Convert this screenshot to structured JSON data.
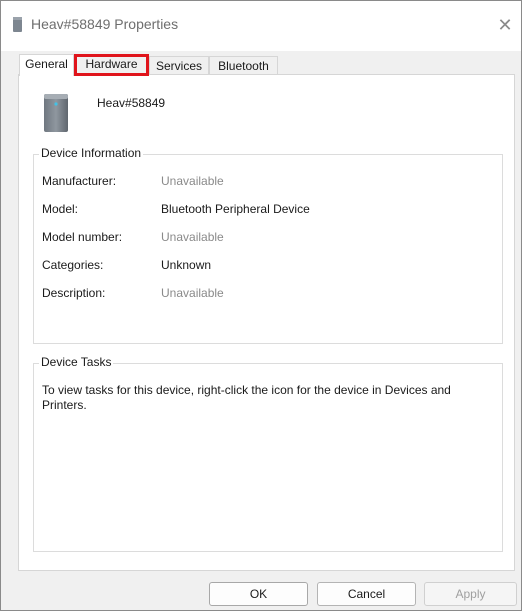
{
  "window": {
    "title": "Heav#58849 Properties"
  },
  "tabs": [
    {
      "label": "General",
      "state": "active"
    },
    {
      "label": "Hardware",
      "state": "highlighted"
    },
    {
      "label": "Services",
      "state": "inactive"
    },
    {
      "label": "Bluetooth",
      "state": "inactive"
    }
  ],
  "device": {
    "name": "Heav#58849",
    "icon": "device-tower-icon"
  },
  "device_information": {
    "title": "Device Information",
    "fields": [
      {
        "label": "Manufacturer:",
        "value": "Unavailable"
      },
      {
        "label": "Model:",
        "value": "Bluetooth Peripheral Device"
      },
      {
        "label": "Model number:",
        "value": "Unavailable"
      },
      {
        "label": "Categories:",
        "value": "Unknown"
      },
      {
        "label": "Description:",
        "value": "Unavailable"
      }
    ]
  },
  "device_tasks": {
    "title": "Device Tasks",
    "text": "To view tasks for this device, right-click the icon for the device in Devices and Printers."
  },
  "buttons": {
    "ok": "OK",
    "cancel": "Cancel",
    "apply": "Apply"
  },
  "colors": {
    "highlight_border": "#e0141b",
    "unavailable_text": "#8a8a8a"
  }
}
